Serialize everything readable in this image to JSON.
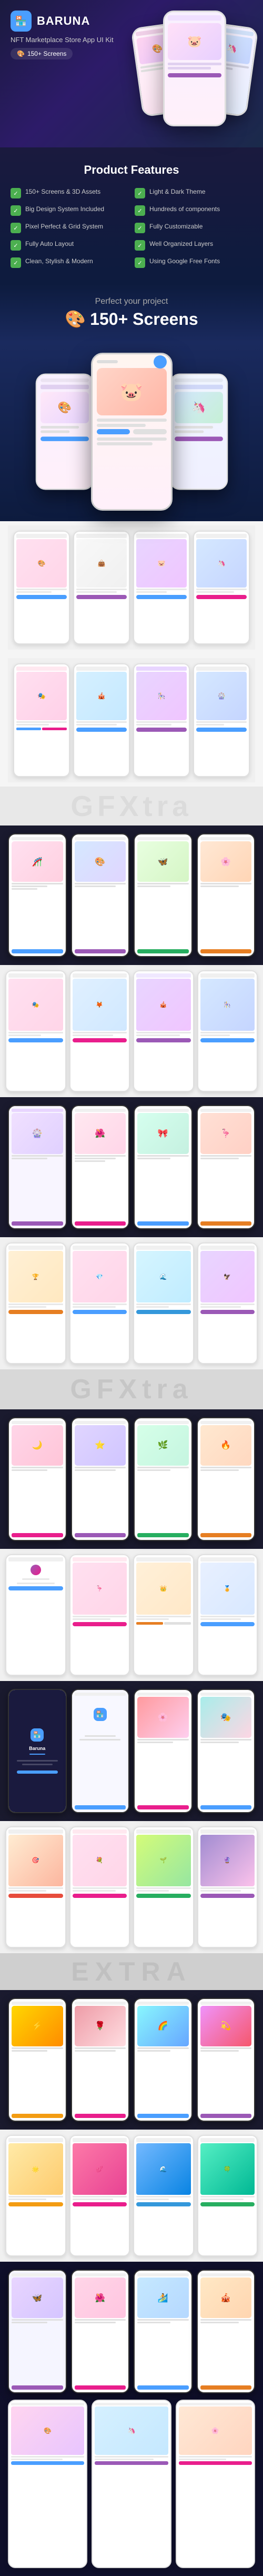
{
  "app": {
    "name": "BARUNA",
    "subtitle": "NFT Marketplace Store App UI Kit",
    "logo_emoji": "🏪",
    "screens_badge": "🎨 150+ Screens"
  },
  "features_section": {
    "title": "Product Features",
    "items": [
      {
        "text": "150+ Screens & 3D Assets",
        "col": 1
      },
      {
        "text": "Light & Dark Theme",
        "col": 2
      },
      {
        "text": "Big Design System Included",
        "col": 1
      },
      {
        "text": "Hundreds of components",
        "col": 2
      },
      {
        "text": "Pixel Perfect & Grid System",
        "col": 1
      },
      {
        "text": "Fully Customizable",
        "col": 2
      },
      {
        "text": "Fully Auto Layout",
        "col": 1
      },
      {
        "text": "Well Organized Layers",
        "col": 2
      },
      {
        "text": "Clean, Stylish & Modern",
        "col": 1
      },
      {
        "text": "Using Google Free Fonts",
        "col": 2
      }
    ]
  },
  "perfect_section": {
    "label": "Perfect your project",
    "screens_label": "🎨 150+ Screens"
  },
  "watermarks": {
    "gfxtra": "GFXtra",
    "extra": "EXTRA"
  },
  "phone_screens": [
    {
      "emoji": "🎨",
      "theme": "pink"
    },
    {
      "emoji": "👜",
      "theme": "light"
    },
    {
      "emoji": "🐷",
      "theme": "purple"
    },
    {
      "emoji": "🦄",
      "theme": "blue"
    },
    {
      "emoji": "🎭",
      "theme": "pink"
    },
    {
      "emoji": "🎪",
      "theme": "light"
    },
    {
      "emoji": "🎠",
      "theme": "purple"
    },
    {
      "emoji": "🎡",
      "theme": "blue"
    },
    {
      "emoji": "🎢",
      "theme": "pink"
    },
    {
      "emoji": "🎨",
      "theme": "light"
    },
    {
      "emoji": "🦋",
      "theme": "purple"
    },
    {
      "emoji": "🌸",
      "theme": "blue"
    },
    {
      "emoji": "🎭",
      "theme": "pink"
    },
    {
      "emoji": "🦊",
      "theme": "light"
    },
    {
      "emoji": "🎪",
      "theme": "purple"
    },
    {
      "emoji": "🎠",
      "theme": "blue"
    }
  ]
}
